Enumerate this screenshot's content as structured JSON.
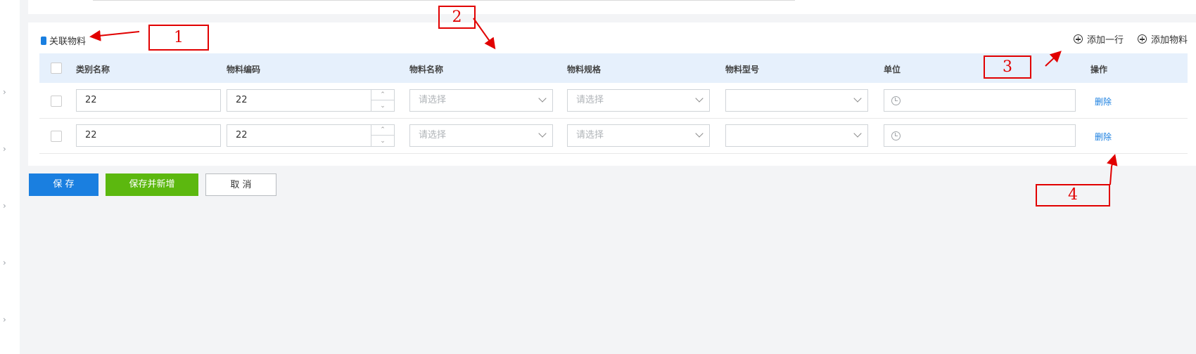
{
  "section": {
    "title": "关联物料"
  },
  "toolbar": {
    "add_row": "添加一行",
    "add_material": "添加物料"
  },
  "table": {
    "columns": [
      "类别名称",
      "物料编码",
      "物料名称",
      "物料规格",
      "物料型号",
      "单位",
      "操作"
    ],
    "rows": [
      {
        "category": "22",
        "code": "22",
        "name_placeholder": "请选择",
        "spec_placeholder": "请选择",
        "model": "",
        "unit": "",
        "action": "删除"
      },
      {
        "category": "22",
        "code": "22",
        "name_placeholder": "请选择",
        "spec_placeholder": "请选择",
        "model": "",
        "unit": "",
        "action": "删除"
      }
    ]
  },
  "buttons": {
    "save": "保 存",
    "save_new": "保存并新增",
    "cancel": "取 消"
  },
  "annotations": {
    "a1": "1",
    "a2": "2",
    "a3": "3",
    "a4": "4"
  },
  "colors": {
    "primary": "#1a7fe0",
    "success": "#5cb80f",
    "annotation": "#e10000",
    "header_bg": "#e6f0fc"
  }
}
